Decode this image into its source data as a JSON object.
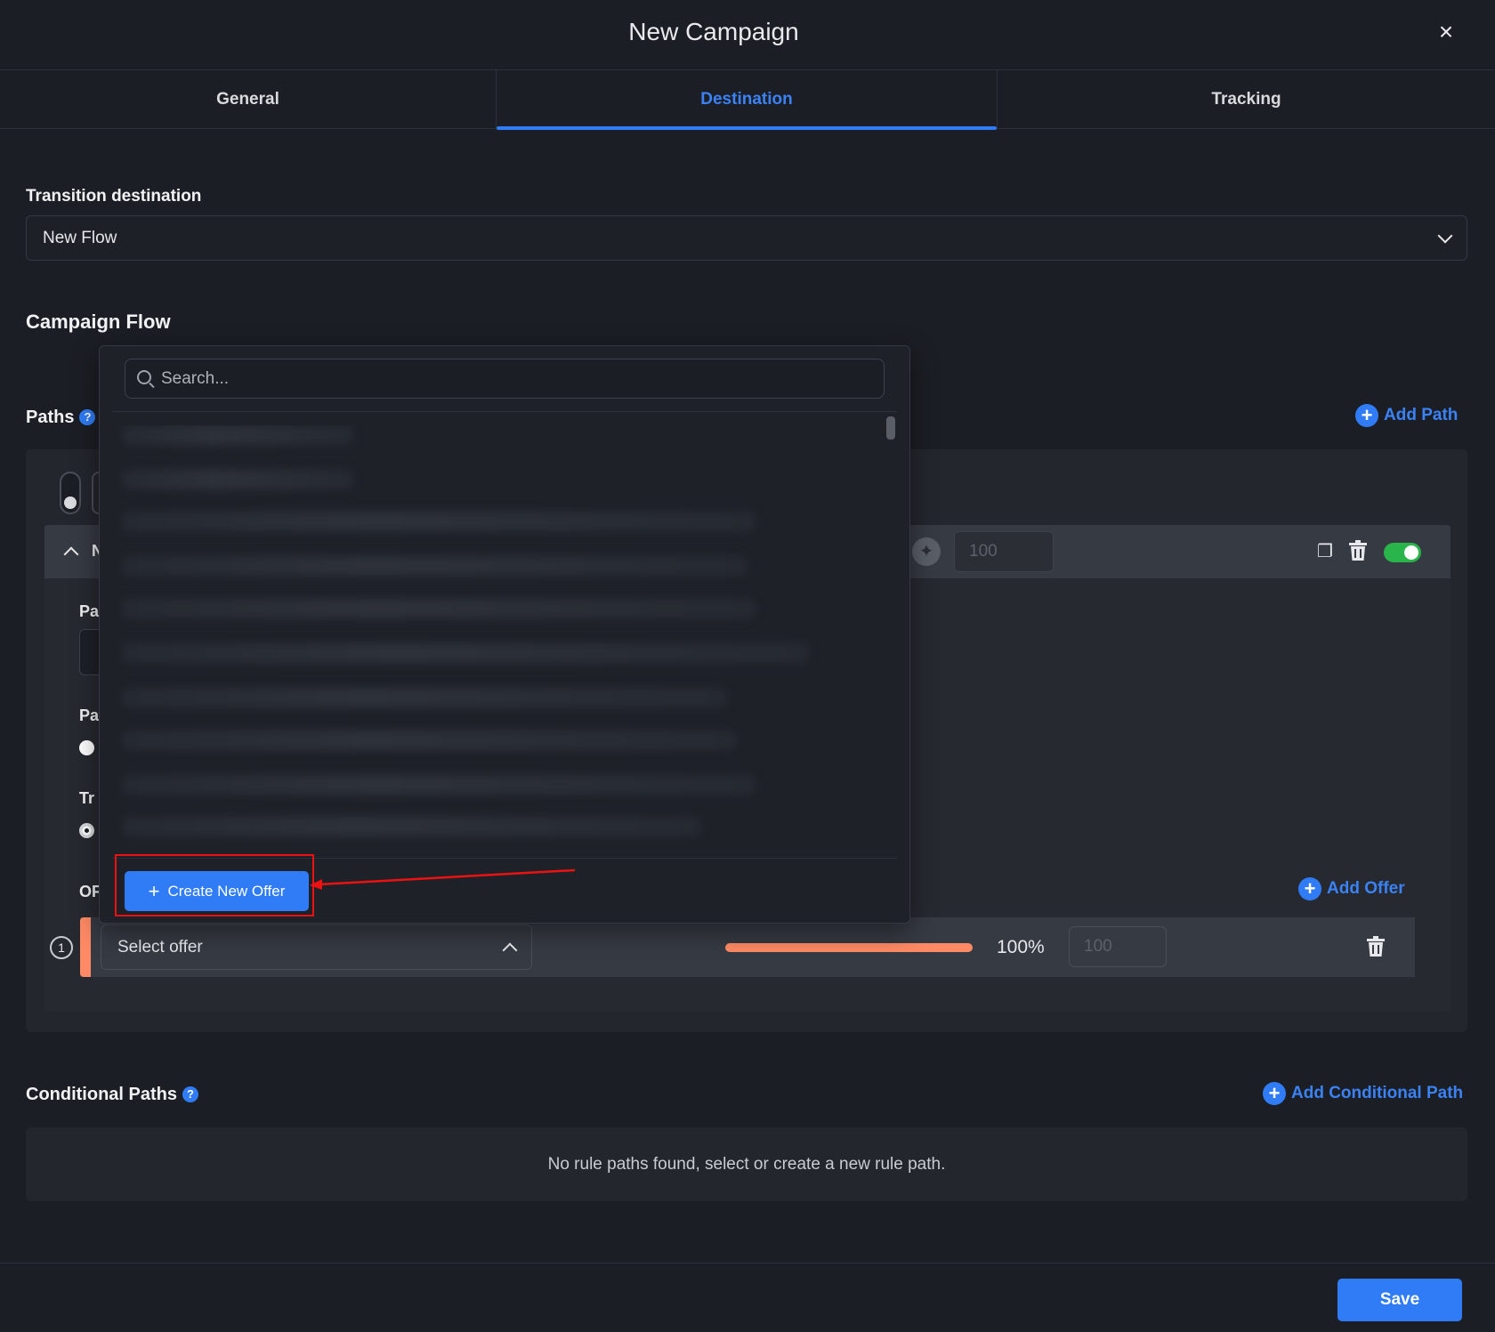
{
  "modal": {
    "title": "New Campaign",
    "close_icon": "×"
  },
  "tabs": [
    {
      "label": "General"
    },
    {
      "label": "Destination"
    },
    {
      "label": "Tracking"
    }
  ],
  "transition": {
    "label": "Transition destination",
    "value": "New Flow"
  },
  "campaign_flow": {
    "title": "Campaign Flow"
  },
  "paths": {
    "title": "Paths",
    "help_icon": "?",
    "add_path_label": "Add Path",
    "weight_value": "100",
    "partial_labels": {
      "pa1": "Pa",
      "pa2": "Pa",
      "tr": "Tr",
      "of": "OF",
      "n": "N"
    }
  },
  "offers": {
    "add_offer_label": "Add Offer",
    "row_index": "1",
    "select_placeholder": "Select offer",
    "share_percent": 1.0,
    "share_label": "100%",
    "weight_value": "100"
  },
  "dropdown": {
    "search_placeholder": "Search...",
    "create_label": "Create New Offer"
  },
  "conditional_paths": {
    "title": "Conditional Paths",
    "help_icon": "?",
    "add_label": "Add Conditional Path",
    "empty_text": "No rule paths found, select or create a new rule path."
  },
  "footer": {
    "save_label": "Save"
  },
  "colors": {
    "accent": "#2f7cf6",
    "toggle_on": "#2ab54a",
    "offer_accent": "#ff8a65",
    "annotation": "#e11111"
  }
}
